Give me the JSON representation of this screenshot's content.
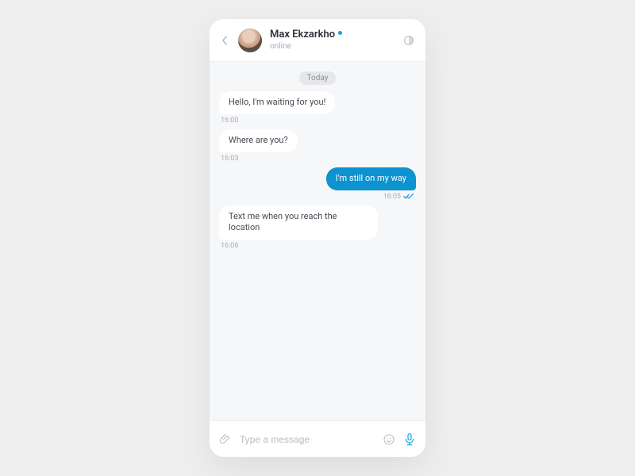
{
  "header": {
    "name": "Max Ekzarkho",
    "status": "online"
  },
  "date_label": "Today",
  "messages": [
    {
      "side": "in",
      "text": "Hello, I'm waiting for you!",
      "time": "16:00",
      "read": false
    },
    {
      "side": "in",
      "text": "Where are you?",
      "time": "16:03",
      "read": false
    },
    {
      "side": "out",
      "text": "I'm still on my way",
      "time": "16:05",
      "read": true
    },
    {
      "side": "in",
      "text": "Text me when you reach the location",
      "time": "16:06",
      "read": false
    }
  ],
  "input": {
    "placeholder": "Type a message"
  }
}
